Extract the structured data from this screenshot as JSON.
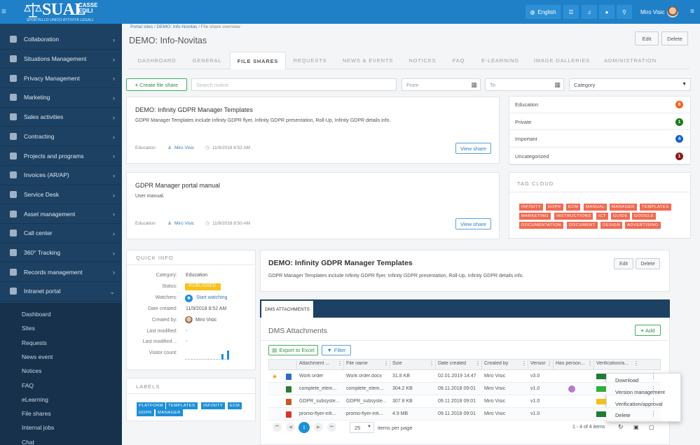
{
  "brand": {
    "word": "SUAL",
    "casse": "CASSE",
    "edili": "EDILI",
    "tagline": "SPORTELLO UNICO ATTIVITÀ LEGALI"
  },
  "topbar": {
    "language": "English",
    "user_name": "Miro Visic",
    "icons": [
      "menu-icon",
      "globe-icon",
      "list-icon",
      "bell-icon",
      "chat-icon",
      "search-icon",
      "hamburger-icon"
    ]
  },
  "sidebar": {
    "items": [
      {
        "label": "Collaboration",
        "icon": "calendar-check-icon"
      },
      {
        "label": "Situations Management",
        "icon": "eye-icon"
      },
      {
        "label": "Privacy Management",
        "icon": "shield-icon"
      },
      {
        "label": "Marketing",
        "icon": "target-icon"
      },
      {
        "label": "Sales activities",
        "icon": "truck-icon"
      },
      {
        "label": "Contracting",
        "icon": "pen-icon"
      },
      {
        "label": "Projects and programs",
        "icon": "sitemap-icon"
      },
      {
        "label": "Invoices (AR/AP)",
        "icon": "file-icon"
      },
      {
        "label": "Service Desk",
        "icon": "wrench-icon"
      },
      {
        "label": "Asset management",
        "icon": "server-icon"
      },
      {
        "label": "Call center",
        "icon": "phone-icon"
      },
      {
        "label": "360° Tracking",
        "icon": "anchor-icon"
      },
      {
        "label": "Records management",
        "icon": "briefcase-icon"
      },
      {
        "label": "Intranet portal",
        "icon": "comment-icon"
      }
    ],
    "subitems": [
      "Dashboard",
      "Sites",
      "Requests",
      "News event",
      "Notices",
      "FAQ",
      "eLearning",
      "File shares",
      "Internal jobs",
      "Chat"
    ]
  },
  "breadcrumb": {
    "a": "Portal sites",
    "b": "DEMO: Info-Novitas",
    "c": "File share overview"
  },
  "page": {
    "title": "DEMO: Info-Novitas",
    "edit": "Edit",
    "delete": "Delete"
  },
  "tabs": [
    "DASHBOARD",
    "GENERAL",
    "FILE SHARES",
    "REQUESTS",
    "NEWS & EVENTS",
    "NOTICES",
    "FAQ",
    "E-LEARNING",
    "IMAGE GALLERIES",
    "ADMINISTRATION"
  ],
  "toolbar": {
    "create": "Create file share",
    "search_placeholder": "Search notice",
    "from": "From",
    "to": "To",
    "category": "Category"
  },
  "shares": [
    {
      "title": "DEMO: Infinity GDPR Manager Templates",
      "desc": "GDPR Manager Templates include Infinity GDPR flyer, Infinity GDPR presentation, Roll-Up, Infinity GDPR details info.",
      "category": "Education",
      "user": "Miro Visic",
      "date": "11/9/2018 8:52 AM",
      "button": "View share"
    },
    {
      "title": "GDPR Manager portal manual",
      "desc": "User manual.",
      "category": "Education",
      "user": "Miro Visic",
      "date": "11/9/2018 8:50 AM",
      "button": "View share"
    }
  ],
  "categories": [
    {
      "name": "Education",
      "count": "6",
      "color": "#f26522"
    },
    {
      "name": "Private",
      "count": "1",
      "color": "#1e7b1e"
    },
    {
      "name": "Important",
      "count": "4",
      "color": "#1a5fd6"
    },
    {
      "name": "Uncategorized",
      "count": "1",
      "color": "#8b1a1a"
    }
  ],
  "tag_cloud": {
    "title": "TAG CLOUD",
    "tags": [
      "INFINITY",
      "GDPR",
      "ECM",
      "MANUAL",
      "MANAGER",
      "TEMPLATES",
      "MARKETING",
      "INSTRUCTIONS",
      "ICT",
      "GUIDE",
      "GOOGLE",
      "DOCUMENTATION",
      "DOCUMENT",
      "DESIGN",
      "ADVERTISING"
    ]
  },
  "quick_info": {
    "title": "QUICK INFO",
    "rows": [
      {
        "label": "Category:",
        "value": "Education"
      },
      {
        "label": "Status:",
        "value": "PUBLISHED"
      },
      {
        "label": "Watchers:",
        "value": "Start watching"
      },
      {
        "label": "Date created:",
        "value": "11/9/2018 8:52 AM"
      },
      {
        "label": "Created by:",
        "value": "Miro Visic"
      },
      {
        "label": "Last modified:",
        "value": "-"
      },
      {
        "label": "Last modified ...",
        "value": "-"
      },
      {
        "label": "Visitor count:",
        "value": ""
      }
    ]
  },
  "labels": {
    "title": "LABELS",
    "items": [
      "PLATFORM",
      "TEMPLATES",
      "INFINITY",
      "ECM",
      "GDPR",
      "MANAGER"
    ]
  },
  "detail": {
    "title": "DEMO: Infinity GDPR Manager Templates",
    "desc": "GDPR Manager Templates include Infinity GDPR flyer, Infinity GDPR presentation, Roll-Up, Infinity GDPR details info.",
    "edit": "Edit",
    "delete": "Delete"
  },
  "dms": {
    "tab": "DMS ATTACHMENTS",
    "title": "DMS Attachments",
    "add": "Add",
    "export": "Export to Excel",
    "filter": "Filter",
    "columns": [
      "Attachment ...",
      "File name",
      "Size",
      "Date created",
      "Created by",
      "Version",
      "Has person...",
      "Verification/a..."
    ],
    "rows": [
      {
        "attachment": "Work order",
        "file": "Work order.docx",
        "size": "31.8 KB",
        "date": "02.01.2019 14:47",
        "by": "Miro Visic",
        "version": "v3.0"
      },
      {
        "attachment": "complete_elem...",
        "file": "complete_elem...",
        "size": "304.2 KB",
        "date": "09.11.2018 09:01",
        "by": "Miro Visic",
        "version": "v1.0"
      },
      {
        "attachment": "GDPR_subsyste...",
        "file": "GDPR_subsyste...",
        "size": "307.8 KB",
        "date": "09.11.2018 09:01",
        "by": "Miro Visic",
        "version": "v1.0"
      },
      {
        "attachment": "promo-flyer-infi...",
        "file": "promo-flyer-infi...",
        "size": "4.9 MB",
        "date": "09.11.2018 09:01",
        "by": "Miro Visic",
        "version": "v1.0"
      }
    ],
    "context_menu": [
      "Download",
      "Version management",
      "Verification/approval",
      "Delete"
    ],
    "pager": {
      "page": "1",
      "page_size": "25",
      "per_page_label": "items per page",
      "summary": "1 - 4 of 4 items"
    }
  },
  "visitor_bars": [
    0.1,
    0.1,
    0.1,
    0.1,
    0.1,
    0.1,
    0.1,
    0.1,
    0.1,
    0.1,
    0.1,
    0.1,
    0.1,
    0.55,
    0.1,
    0.95
  ]
}
